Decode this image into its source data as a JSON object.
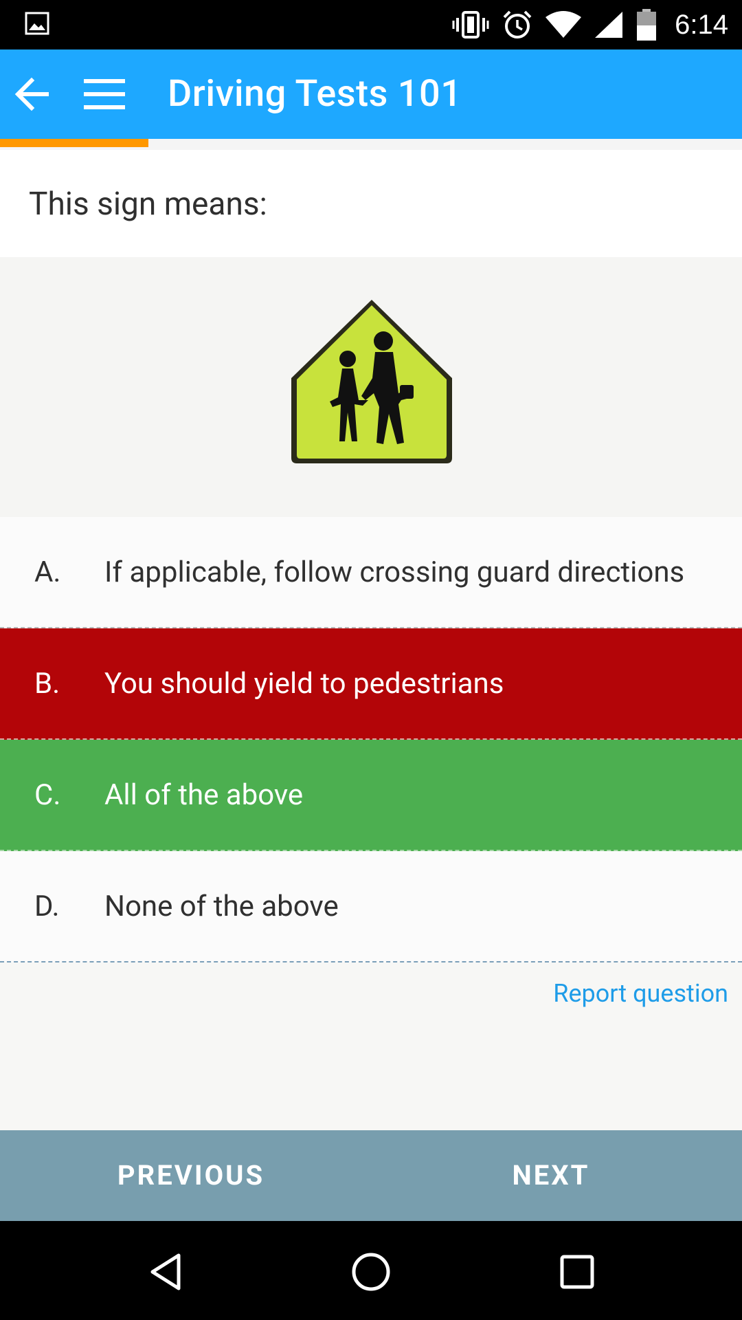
{
  "status_bar": {
    "time": "6:14",
    "icons": [
      "image-icon",
      "vibrate-icon",
      "alarm-icon",
      "wifi-icon",
      "signal-icon",
      "battery-icon"
    ]
  },
  "app_bar": {
    "title": "Driving Tests 101",
    "icons": [
      "back-arrow-icon",
      "hamburger-menu-icon"
    ],
    "color": "#1ea8ff"
  },
  "progress": {
    "fraction": 0.25,
    "color": "#ff9800"
  },
  "question": {
    "text": "This sign means:",
    "image": "school-crossing-sign"
  },
  "answers": [
    {
      "letter": "A.",
      "text": "If applicable, follow crossing guard directions",
      "state": "neutral"
    },
    {
      "letter": "B.",
      "text": "You should yield to pedestrians",
      "state": "wrong"
    },
    {
      "letter": "C.",
      "text": "All of the above",
      "state": "correct"
    },
    {
      "letter": "D.",
      "text": "None of the above",
      "state": "neutral"
    }
  ],
  "colors": {
    "wrong": "#b30508",
    "correct": "#4caf50",
    "link": "#1e9ce8",
    "bottom_bar": "#789eae"
  },
  "report_link": "Report question",
  "bottom_bar": {
    "previous": "PREVIOUS",
    "next": "NEXT"
  },
  "system_nav": [
    "back-triangle-icon",
    "home-circle-icon",
    "recents-square-icon"
  ]
}
